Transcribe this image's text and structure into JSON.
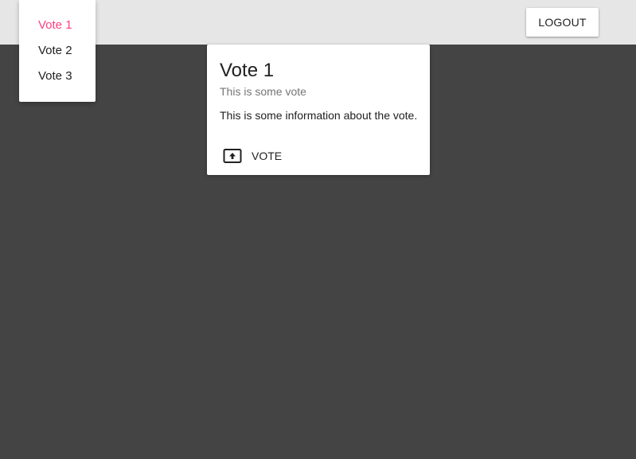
{
  "header": {
    "logout_label": "LOGOUT"
  },
  "menu": {
    "items": [
      {
        "label": "Vote 1",
        "active": true
      },
      {
        "label": "Vote 2",
        "active": false
      },
      {
        "label": "Vote 3",
        "active": false
      }
    ]
  },
  "card": {
    "title": "Vote 1",
    "subtitle": "This is some vote",
    "text": "This is some information about the vote.",
    "vote_label": "VOTE",
    "vote_icon": "upload-icon"
  },
  "colors": {
    "background": "#444444",
    "topbar": "#e6e6e6",
    "accent": "#ff4081",
    "card": "#ffffff"
  }
}
